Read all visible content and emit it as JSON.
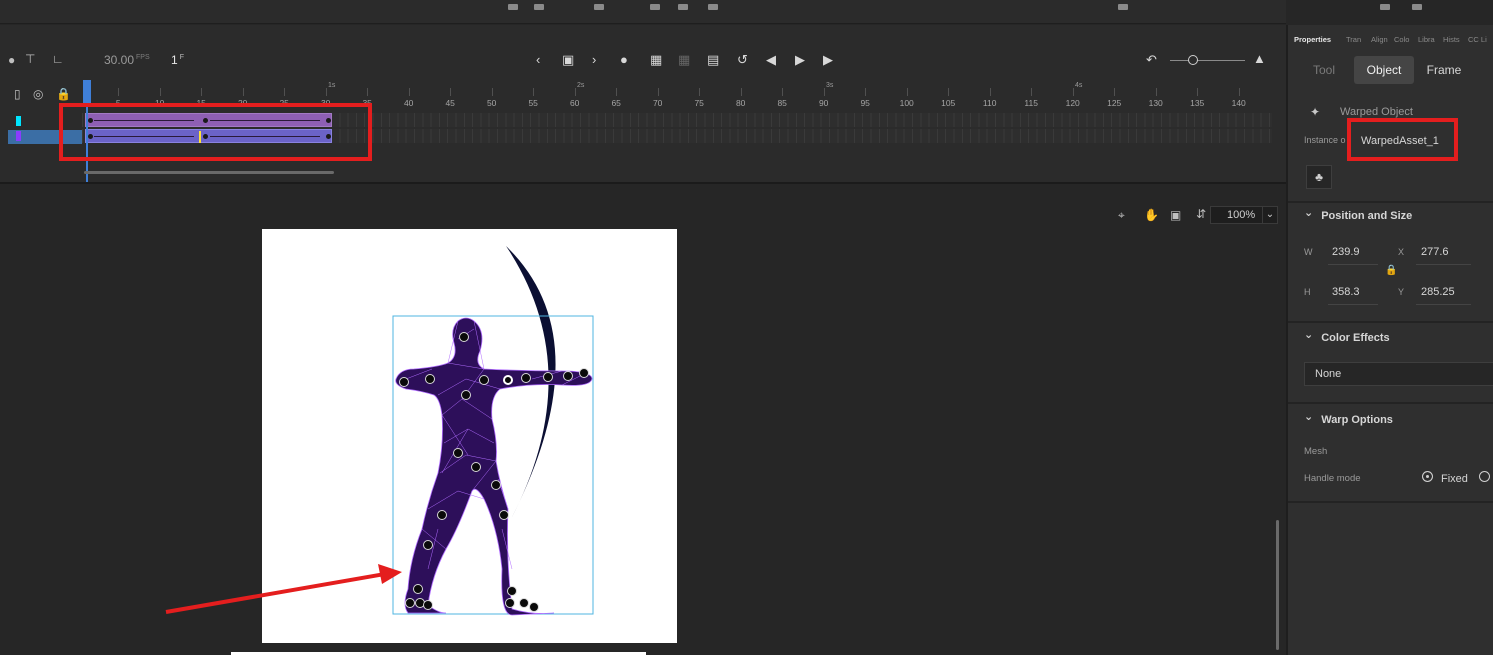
{
  "timeline": {
    "fps_value": "30.00",
    "fps_unit": "FPS",
    "current_frame": "1",
    "frame_unit": "F",
    "seconds": [
      "1s",
      "2s",
      "3s",
      "4s"
    ],
    "frame_numbers": [
      "5",
      "10",
      "15",
      "20",
      "25",
      "30",
      "35",
      "40",
      "45",
      "50",
      "55",
      "60",
      "65",
      "70",
      "75",
      "80",
      "85",
      "90",
      "95",
      "100",
      "105",
      "110",
      "115",
      "120",
      "125",
      "130",
      "135",
      "140"
    ],
    "layer_colors": [
      "#00e5ff",
      "#8a3cff"
    ],
    "span_color": "#8e5fb4",
    "playhead_color": "#3f7fd8"
  },
  "stage": {
    "zoom": "100%",
    "canvas_color": "#ffffff",
    "figure_color": "#2d0f5a",
    "mesh_color": "#b06bff",
    "bow_color": "#0b0f33",
    "bbox_color": "#4fb4e0"
  },
  "annotation": {
    "color": "#e41e1e"
  },
  "properties": {
    "tabs": [
      "Properties",
      "Tran",
      "Align",
      "Colo",
      "Libra",
      "Hists",
      "CC Li"
    ],
    "seg": [
      "Tool",
      "Object",
      "Frame"
    ],
    "object_type": "Warped Object",
    "instance_label": "Instance o",
    "instance_name": "WarpedAsset_1",
    "position_size": {
      "title": "Position and Size",
      "w_label": "W",
      "w": "239.9",
      "h_label": "H",
      "h": "358.3",
      "x_label": "X",
      "x": "277.6",
      "y_label": "Y",
      "y": "285.25"
    },
    "color_effects": {
      "title": "Color Effects",
      "value": "None"
    },
    "warp_options": {
      "title": "Warp Options",
      "mesh_label": "Mesh",
      "handle_mode_label": "Handle mode",
      "fixed_label": "Fixed"
    }
  }
}
